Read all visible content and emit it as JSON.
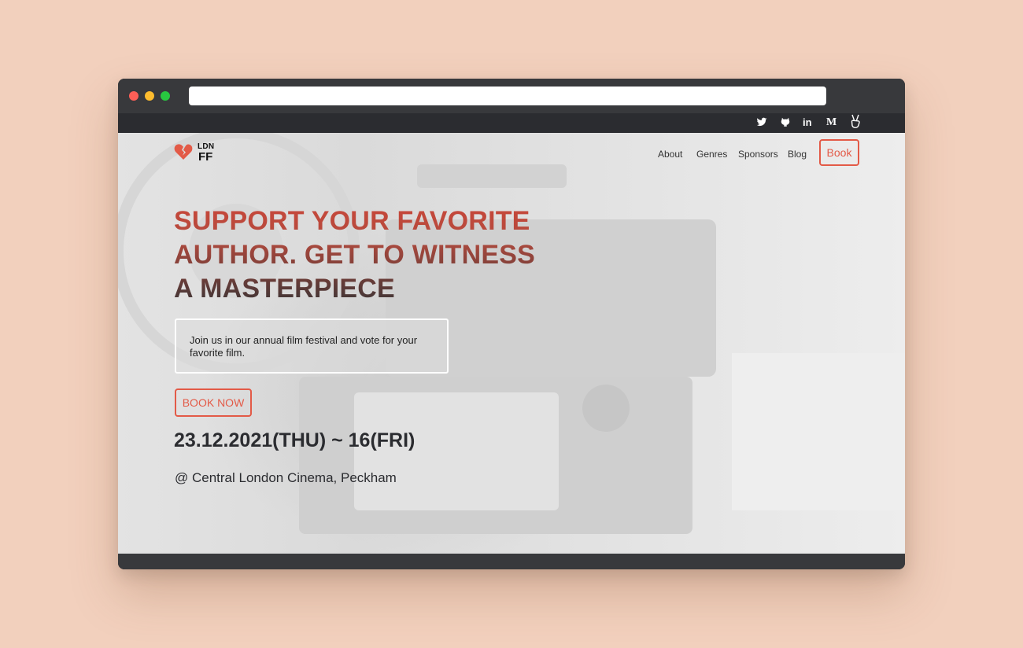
{
  "browser": {
    "url": ""
  },
  "social": {
    "icons": [
      "twitter-icon",
      "github-icon",
      "linkedin-icon",
      "medium-icon",
      "angellist-icon"
    ],
    "linkedin_glyph": "in",
    "medium_glyph": "M"
  },
  "header": {
    "logo_top": "LDN",
    "logo_bottom": "FF",
    "nav": [
      "About",
      "Genres",
      "Sponsors",
      "Blog"
    ],
    "book_label": "Book"
  },
  "hero": {
    "headline_lines": [
      "SUPPORT YOUR FAVORITE",
      "AUTHOR. GET TO WITNESS",
      "A MASTERPIECE"
    ],
    "intro": "Join us in our annual film festival and vote for your favorite film.",
    "cta_label": "BOOK NOW",
    "date": "23.12.2021(THU) ~ 16(FRI)",
    "venue": "@ Central London Cinema, Peckham"
  },
  "colors": {
    "accent": "#e35a47",
    "background": "#f2d0bd",
    "dark": "#2b2c30"
  }
}
